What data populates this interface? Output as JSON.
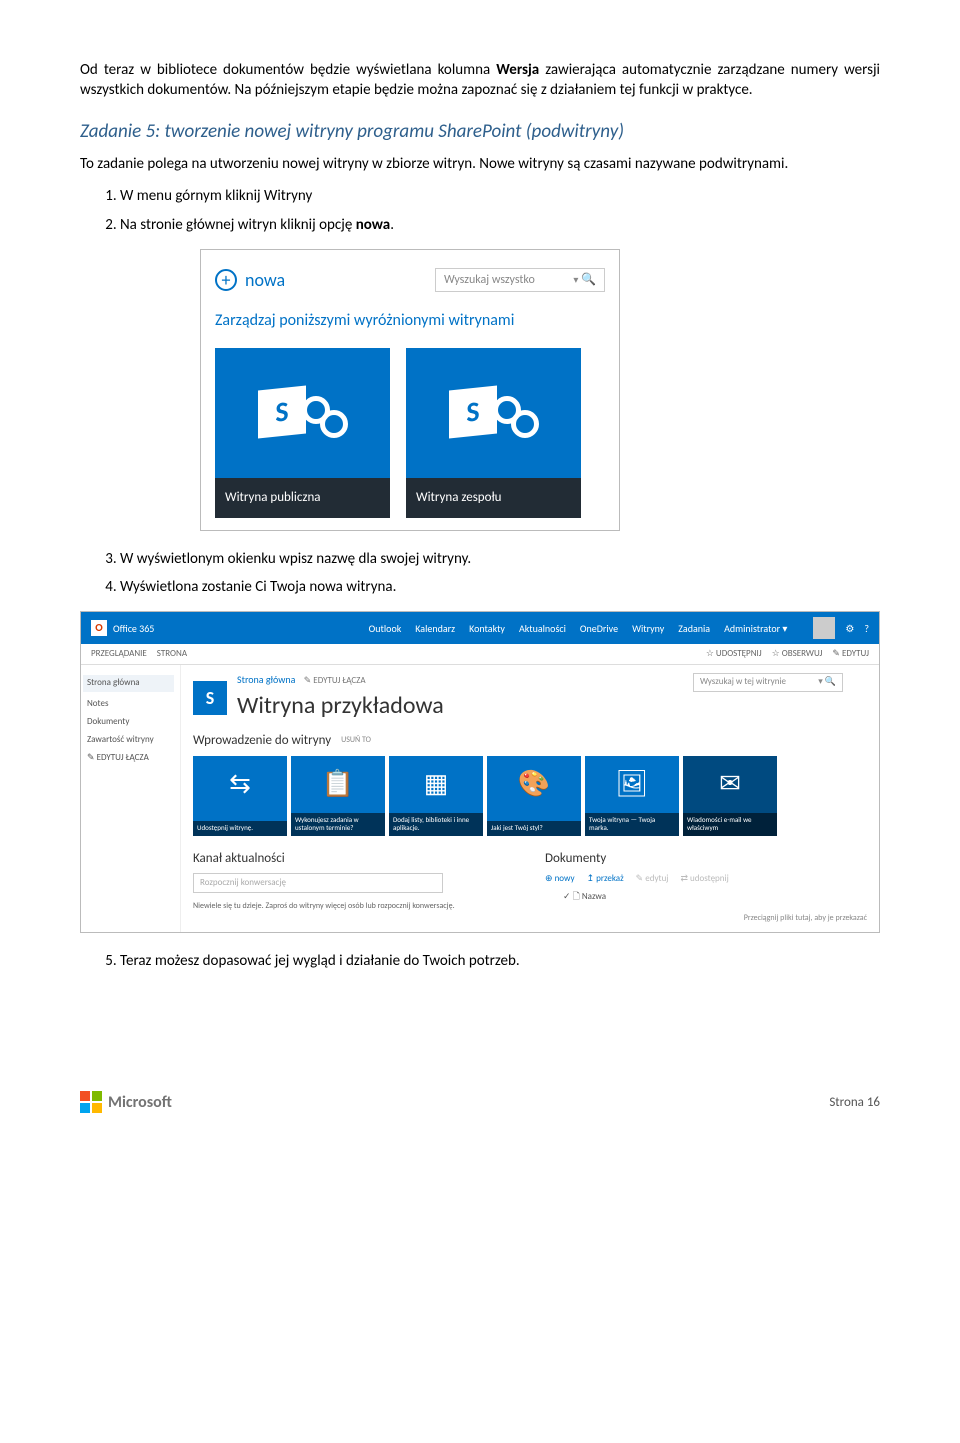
{
  "p1a": "Od teraz w bibliotece dokumentów będzie wyświetlana kolumna ",
  "p1b": "Wersja",
  "p1c": " zawierająca automatycznie zarządzane numery wersji wszystkich dokumentów. Na późniejszym etapie będzie można zapoznać się z działaniem tej funkcji w praktyce.",
  "task_heading": "Zadanie 5: tworzenie nowej witryny programu SharePoint (podwitryny)",
  "p2": "To zadanie polega na utworzeniu nowej witryny w zbiorze witryn. Nowe witryny są czasami nazywane podwitrynami.",
  "list1": {
    "i1": "W menu górnym kliknij Witryny",
    "i2a": "Na stronie głównej witryn kliknij opcję ",
    "i2b": "nowa",
    "i2c": ".",
    "i3": "W wyświetlonym okienku wpisz nazwę dla swojej witryny.",
    "i4": "Wyświetlona zostanie Ci Twoja nowa witryna.",
    "i5": "Teraz możesz dopasować jej wygląd i działanie do Twoich potrzeb."
  },
  "shot1": {
    "nowa": "nowa",
    "search": "Wyszukaj wszystko",
    "manage": "Zarządzaj poniższymi wyróżnionymi witrynami",
    "tile1": "Witryna publiczna",
    "tile2": "Witryna zespołu",
    "s_letter": "S"
  },
  "shot2": {
    "brand": "Office 365",
    "nav": {
      "outlook": "Outlook",
      "kalendarz": "Kalendarz",
      "kontakty": "Kontakty",
      "aktualnosci": "Aktualności",
      "onedrive": "OneDrive",
      "witryny": "Witryny",
      "zadania": "Zadania",
      "admin": "Administrator ▾"
    },
    "gear": "⚙",
    "help": "?",
    "subl": {
      "przegladanie": "PRZEGLĄDANIE",
      "strona": "STRONA"
    },
    "subr": {
      "udostepnij": "☆ UDOSTĘPNIJ",
      "obserwuj": "☆ OBSERWUJ",
      "edytuj": "✎ EDYTUJ"
    },
    "leftnav": {
      "strona_glowna": "Strona główna",
      "notes": "Notes",
      "dokumenty": "Dokumenty",
      "zawartosc": "Zawartość witryny",
      "edytuj_lacza": "✎ EDYTUJ ŁĄCZA"
    },
    "crumb": "Strona główna",
    "edyt": "✎ EDYTUJ ŁĄCZA",
    "title": "Witryna przykładowa",
    "search": "Wyszukaj w tej witrynie",
    "intro": "Wprowadzenie do witryny",
    "usun": "USUŃ TO",
    "tiles": {
      "t1": "Udostępnij witrynę.",
      "t2": "Wykonujesz zadania w ustalonym terminie?",
      "t3": "Dodaj listy, biblioteki i inne aplikacje.",
      "t4": "Jaki jest Twój styl?",
      "t5": "Twoja witryna — Twoja marka.",
      "t6": "Wiadomości e-mail we właściwym"
    },
    "kanal": "Kanał aktualności",
    "konw_ph": "Rozpocznij konwersację",
    "note": "Niewiele się tu dzieje. Zaproś do witryny więcej osób lub rozpocznij konwersację.",
    "dokumenty": "Dokumenty",
    "actions": {
      "nowy": "⊕ nowy",
      "przekaz": "↥ przekaż",
      "edytuj": "✎ edytuj",
      "udostepnij": "⇄ udostępnij"
    },
    "name_col": "✓  🗋  Nazwa",
    "drag": "Przeciągnij pliki tutaj, aby je przekazać"
  },
  "footer": {
    "ms": "Microsoft",
    "page": "Strona 16"
  }
}
